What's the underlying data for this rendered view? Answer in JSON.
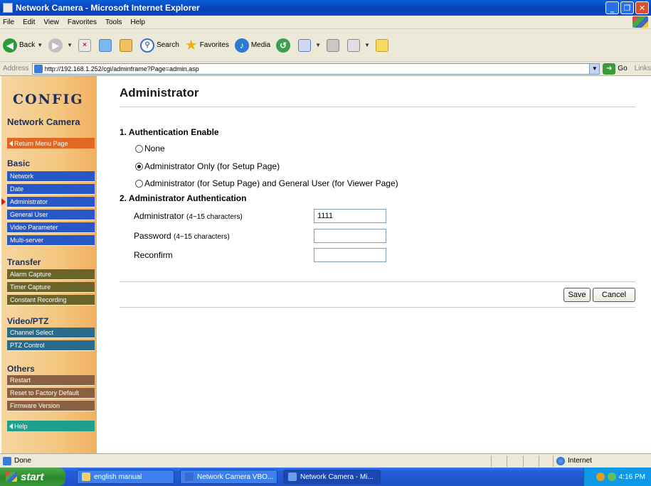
{
  "window": {
    "title": "Network Camera - Microsoft Internet Explorer"
  },
  "menu": [
    "File",
    "Edit",
    "View",
    "Favorites",
    "Tools",
    "Help"
  ],
  "toolbar": {
    "back": "Back",
    "search": "Search",
    "favorites": "Favorites",
    "media": "Media"
  },
  "address": {
    "label": "Address",
    "url": "http://192.168.1.252/cgi/adminframe?Page=admin.asp",
    "go": "Go",
    "links": "Links"
  },
  "sidebar": {
    "logo": "CONFIG",
    "subtitle": "Network Camera",
    "return_label": "Return Menu Page",
    "help_label": "Help",
    "groups": [
      {
        "title": "Basic",
        "items": [
          "Network",
          "Date",
          "Administrator",
          "General User",
          "Video Parameter",
          "Multi-server"
        ]
      },
      {
        "title": "Transfer",
        "items": [
          "Alarm Capture",
          "Timer Capture",
          "Constant Recording"
        ]
      },
      {
        "title": "Video/PTZ",
        "items": [
          "Channel Select",
          "PTZ Control"
        ]
      },
      {
        "title": "Others",
        "items": [
          "Restart",
          "Reset to Factory Default",
          "Firmware Version"
        ]
      }
    ]
  },
  "main": {
    "title": "Administrator",
    "section1": "1. Authentication Enable",
    "options": [
      {
        "label": "None",
        "checked": false
      },
      {
        "label": "Administrator Only (for Setup Page)",
        "checked": true
      },
      {
        "label": "Administrator (for Setup Page) and General User (for Viewer Page)",
        "checked": false
      }
    ],
    "section2": "2. Administrator Authentication",
    "fields": {
      "admin_label": "Administrator",
      "admin_hint": "(4~15 characters)",
      "admin_value": "1111",
      "password_label": "Password",
      "password_hint": "(4~15 characters)",
      "password_value": "",
      "reconfirm_label": "Reconfirm",
      "reconfirm_value": ""
    },
    "save": "Save",
    "cancel": "Cancel"
  },
  "status": {
    "left": "Done",
    "zone": "Internet"
  },
  "taskbar": {
    "start": "start",
    "tasks": [
      "english manual",
      "Network Camera VBO...",
      "Network Camera - Mi..."
    ],
    "clock": "4:16 PM"
  }
}
